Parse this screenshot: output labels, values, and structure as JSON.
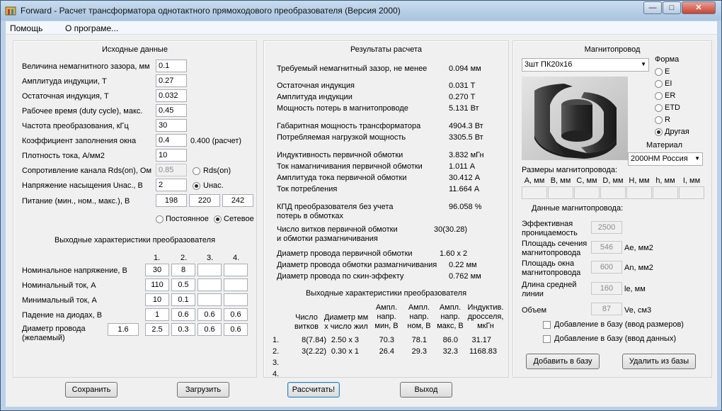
{
  "window": {
    "title": "Forward - Расчет трансформатора однотактного прямоходового преобразователя (Версия 2000)"
  },
  "menu": {
    "help": "Помощь",
    "about": "О програме..."
  },
  "input": {
    "title": "Исходные данные",
    "rows": [
      {
        "label": "Величина немагнитного зазора, мм",
        "value": "0.1"
      },
      {
        "label": "Амплитуда индукции, Т",
        "value": "0.27"
      },
      {
        "label": "Остаточная индукция, Т",
        "value": "0.032"
      },
      {
        "label": "Рабочее время (duty cycle), макс.",
        "value": "0.45"
      },
      {
        "label": "Частота преобразования, кГц",
        "value": "30"
      },
      {
        "label": "Коэффициент заполнения окна",
        "value": "0.4"
      },
      {
        "label": "Плотность тока, А/мм2",
        "value": "10"
      },
      {
        "label": "Сопротивление канала Rds(on), Ом",
        "value": "0.85"
      },
      {
        "label": "Напряжение насыщения Uнас., В",
        "value": "2"
      }
    ],
    "fill_calc": "0.400 (расчет)",
    "rds_radio": "Rds(on)",
    "usat_radio": "Uнас.",
    "supply_label": "Питание (мин., ном., макс.), В",
    "supply": [
      "198",
      "220",
      "242"
    ],
    "dc_radio": "Постоянное",
    "ac_radio": "Сетевое"
  },
  "outputs": {
    "title": "Выходные характеристики преобразователя",
    "cols": [
      "1.",
      "2.",
      "3.",
      "4."
    ],
    "rows": [
      {
        "label": "Номинальное напряжение, В",
        "vals": [
          "30",
          "8",
          "",
          ""
        ]
      },
      {
        "label": "Номинальный ток, А",
        "vals": [
          "110",
          "0.5",
          "",
          ""
        ]
      },
      {
        "label": "Минимальный ток, А",
        "vals": [
          "10",
          "0.1",
          "",
          ""
        ]
      },
      {
        "label": "Падение на диодах, В",
        "vals": [
          "1",
          "0.6",
          "0.6",
          "0.6"
        ]
      }
    ],
    "wire_label1": "Диаметр провода",
    "wire_label2": "(желаемый)",
    "wire_extra": "1.6",
    "wire_vals": [
      "2.5",
      "0.3",
      "0.6",
      "0.6"
    ]
  },
  "results": {
    "title": "Результаты расчета",
    "lines": [
      {
        "label": "Требуемый немагнитный зазор, не менее",
        "value": "0.094 мм"
      },
      {
        "label": "Остаточная индукция",
        "value": "0.031 Т"
      },
      {
        "label": "Амплитуда индукции",
        "value": "0.270 Т"
      },
      {
        "label": "Мощность потерь в магнитопроводе",
        "value": "5.131 Вт"
      },
      {
        "label": "Габаритная мощность трансформатора",
        "value": "4904.3 Вт"
      },
      {
        "label": "Потребляемая нагрузкой мощность",
        "value": "3305.5 Вт"
      },
      {
        "label": "Индуктивность первичной обмотки",
        "value": "3.832 мГн"
      },
      {
        "label": "Ток намагничивания первичной обмотки",
        "value": "1.011 А"
      },
      {
        "label": "Амплитуда тока первичной обмотки",
        "value": "30.412 А"
      },
      {
        "label": "Ток потребления",
        "value": "11.664 А"
      }
    ],
    "eff_label1": "КПД преобразователя без учета",
    "eff_label2": "потерь в обмотках",
    "eff_value": "96.058 %",
    "turns_label1": "Число витков первичной обмотки",
    "turns_label2": "и обмотки размагничивания",
    "turns_value": "30(30.28)",
    "dia_lines": [
      {
        "label": "Диаметр провода первичной обмотки",
        "value": "1.60 x 2"
      },
      {
        "label": "Диаметр провода обмотки размагничивания",
        "value": "0.22 мм"
      },
      {
        "label": "Диаметр провода по скин-эффекту",
        "value": "0.762 мм"
      }
    ],
    "out_title": "Выходные характеристики преобразователя",
    "table_headers": [
      [
        "Число",
        "витков"
      ],
      [
        "Диаметр мм",
        "х число жил"
      ],
      [
        "Ампл.",
        "напр.",
        "мин, В"
      ],
      [
        "Ампл.",
        "напр.",
        "ном, В"
      ],
      [
        "Ампл.",
        "напр.",
        "макс, В"
      ],
      [
        "Индуктив.",
        "дросселя,",
        "мкГн"
      ]
    ],
    "table_rows": [
      {
        "idx": "1.",
        "turns": "8(7.84)",
        "dia": "2.50 x 3",
        "umin": "70.3",
        "unom": "78.1",
        "umax": "86.0",
        "ind": "31.17"
      },
      {
        "idx": "2.",
        "turns": "3(2.22)",
        "dia": "0.30 x 1",
        "umin": "26.4",
        "unom": "29.3",
        "umax": "32.3",
        "ind": "1168.83"
      },
      {
        "idx": "3.",
        "turns": "",
        "dia": "",
        "umin": "",
        "unom": "",
        "umax": "",
        "ind": ""
      },
      {
        "idx": "4.",
        "turns": "",
        "dia": "",
        "umin": "",
        "unom": "",
        "umax": "",
        "ind": ""
      }
    ]
  },
  "core": {
    "title": "Магнитопровод",
    "selected": "3шт ПК20х16",
    "shape_title": "Форма",
    "shapes": [
      "E",
      "EI",
      "ER",
      "ETD",
      "R",
      "Другая"
    ],
    "material_title": "Материал",
    "material": "2000НМ Россия",
    "dims_title": "Размеры магнитопровода:",
    "dims": [
      "А, мм",
      "В, мм",
      "С, мм",
      "D, мм",
      "Н, мм",
      "h, мм",
      "I, мм"
    ],
    "data_title": "Данные магнитопровода:",
    "params": [
      {
        "label1": "Эффективная",
        "label2": "проницаемость",
        "value": "2500",
        "unit": ""
      },
      {
        "label1": "Площадь сечения",
        "label2": "магнитопровода",
        "value": "546",
        "unit": "Ae, мм2"
      },
      {
        "label1": "Площадь окна",
        "label2": "магнитопровода",
        "value": "600",
        "unit": "An, мм2"
      },
      {
        "label1": "Длина средней",
        "label2": "линии",
        "value": "160",
        "unit": "le, мм"
      },
      {
        "label1": "Объем",
        "label2": "",
        "value": "87",
        "unit": "Ve, см3"
      }
    ],
    "chk_dims": "Добавление в базу (ввод размеров)",
    "chk_data": "Добавление в базу (ввод данных)",
    "add_btn": "Добавить в базу",
    "del_btn": "Удалить из базы"
  },
  "buttons": {
    "save": "Сохранить",
    "load": "Загрузить",
    "calc": "Рассчитать!",
    "exit": "Выход"
  },
  "colors": {
    "window_frame": "#bcd1e8",
    "panel": "#f0f0f0",
    "close": "#c8432f"
  }
}
